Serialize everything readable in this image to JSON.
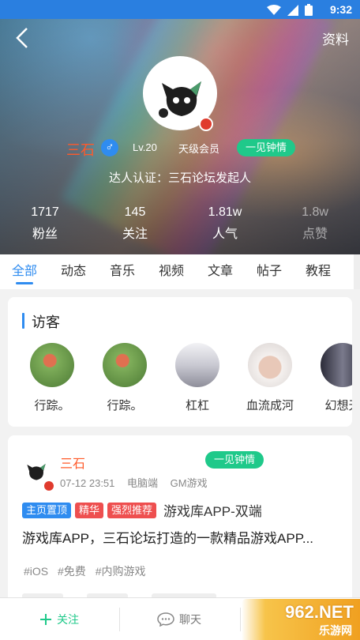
{
  "status_bar": {
    "time": "9:32",
    "icons": [
      "wifi-icon",
      "signal-icon",
      "battery-icon"
    ]
  },
  "header": {
    "profile_label": "资料"
  },
  "user": {
    "name": "三石",
    "gender": "♂",
    "level": "Lv.20",
    "member": "天级会员",
    "mood": "一见钟情",
    "verification": "达人认证：三石论坛发起人"
  },
  "stats": [
    {
      "value": "1717",
      "label": "粉丝"
    },
    {
      "value": "145",
      "label": "关注"
    },
    {
      "value": "1.81w",
      "label": "人气"
    },
    {
      "value": "1.8w",
      "label": "点赞"
    }
  ],
  "tabs": [
    "全部",
    "动态",
    "音乐",
    "视频",
    "文章",
    "帖子",
    "教程"
  ],
  "visitors": {
    "title": "访客",
    "items": [
      {
        "name": "行踪。",
        "color": "#6e9a4a"
      },
      {
        "name": "行踪。",
        "color": "#6e9a4a"
      },
      {
        "name": "杠杠",
        "color": "#cfcfd6"
      },
      {
        "name": "血流成河",
        "color": "#e8e2e0"
      },
      {
        "name": "幻想天",
        "color": "#5a5a6a"
      }
    ]
  },
  "post": {
    "author": "三石",
    "mood": "一见钟情",
    "date": "07-12 23:51",
    "device": "电脑端",
    "category": "GM游戏",
    "badges": [
      "主页置顶",
      "精华",
      "强烈推荐"
    ],
    "title": "游戏库APP-双端",
    "body": "游戏库APP，三石论坛打造的一款精品游戏APP...",
    "hashtags": [
      "#iOS",
      "#免费",
      "#内购游戏"
    ]
  },
  "bottom_bar": {
    "follow_label": "关注",
    "chat_label": "聊天"
  },
  "watermark": {
    "text": "962.NET",
    "sub": "乐游网"
  },
  "colors": {
    "accent": "#2f8cf0",
    "name": "#ff5a2a",
    "mood": "#1fc98a",
    "badge_red": "#ee4f4f"
  }
}
